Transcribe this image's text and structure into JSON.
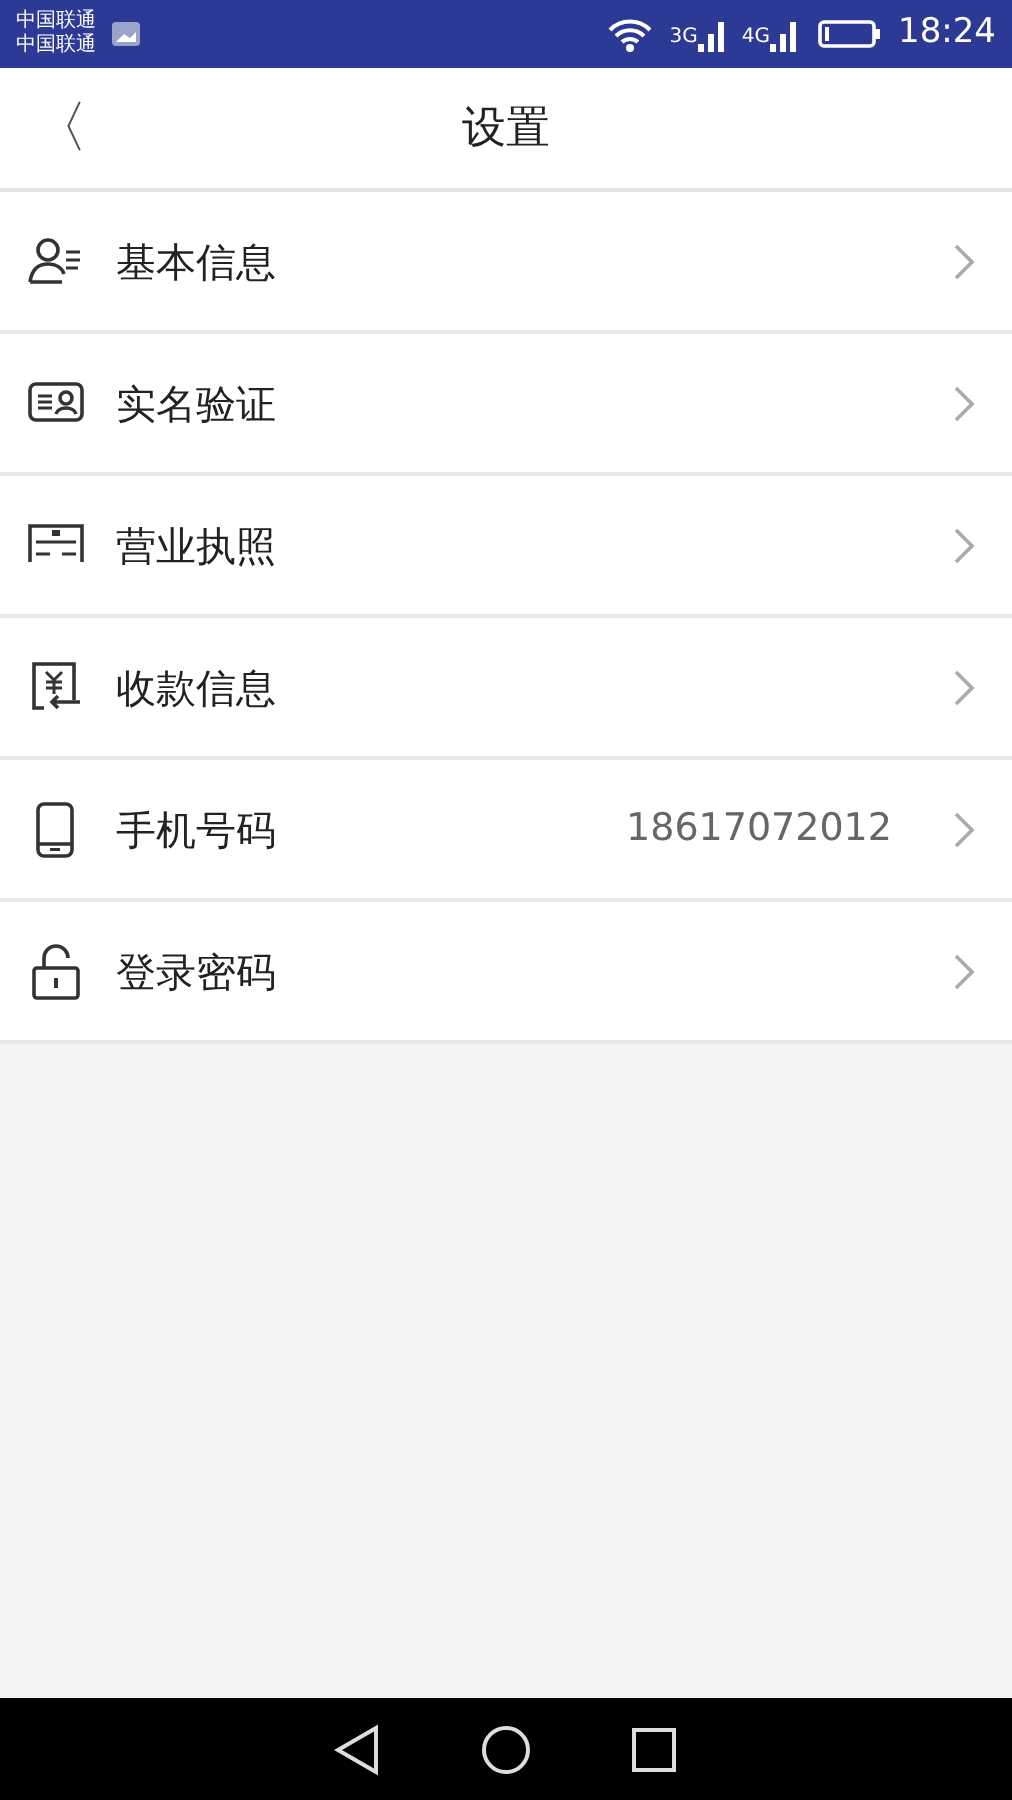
{
  "status_bar": {
    "carriers": [
      "中国联通",
      "中国联通"
    ],
    "networks": [
      "3G",
      "4G"
    ],
    "time": "18:24"
  },
  "header": {
    "back": "〈",
    "title": "设置"
  },
  "items": [
    {
      "label": "基本信息"
    },
    {
      "label": "实名验证"
    },
    {
      "label": "营业执照"
    },
    {
      "label": "收款信息"
    },
    {
      "label": "手机号码",
      "value": "18617072012"
    },
    {
      "label": "登录密码"
    }
  ]
}
